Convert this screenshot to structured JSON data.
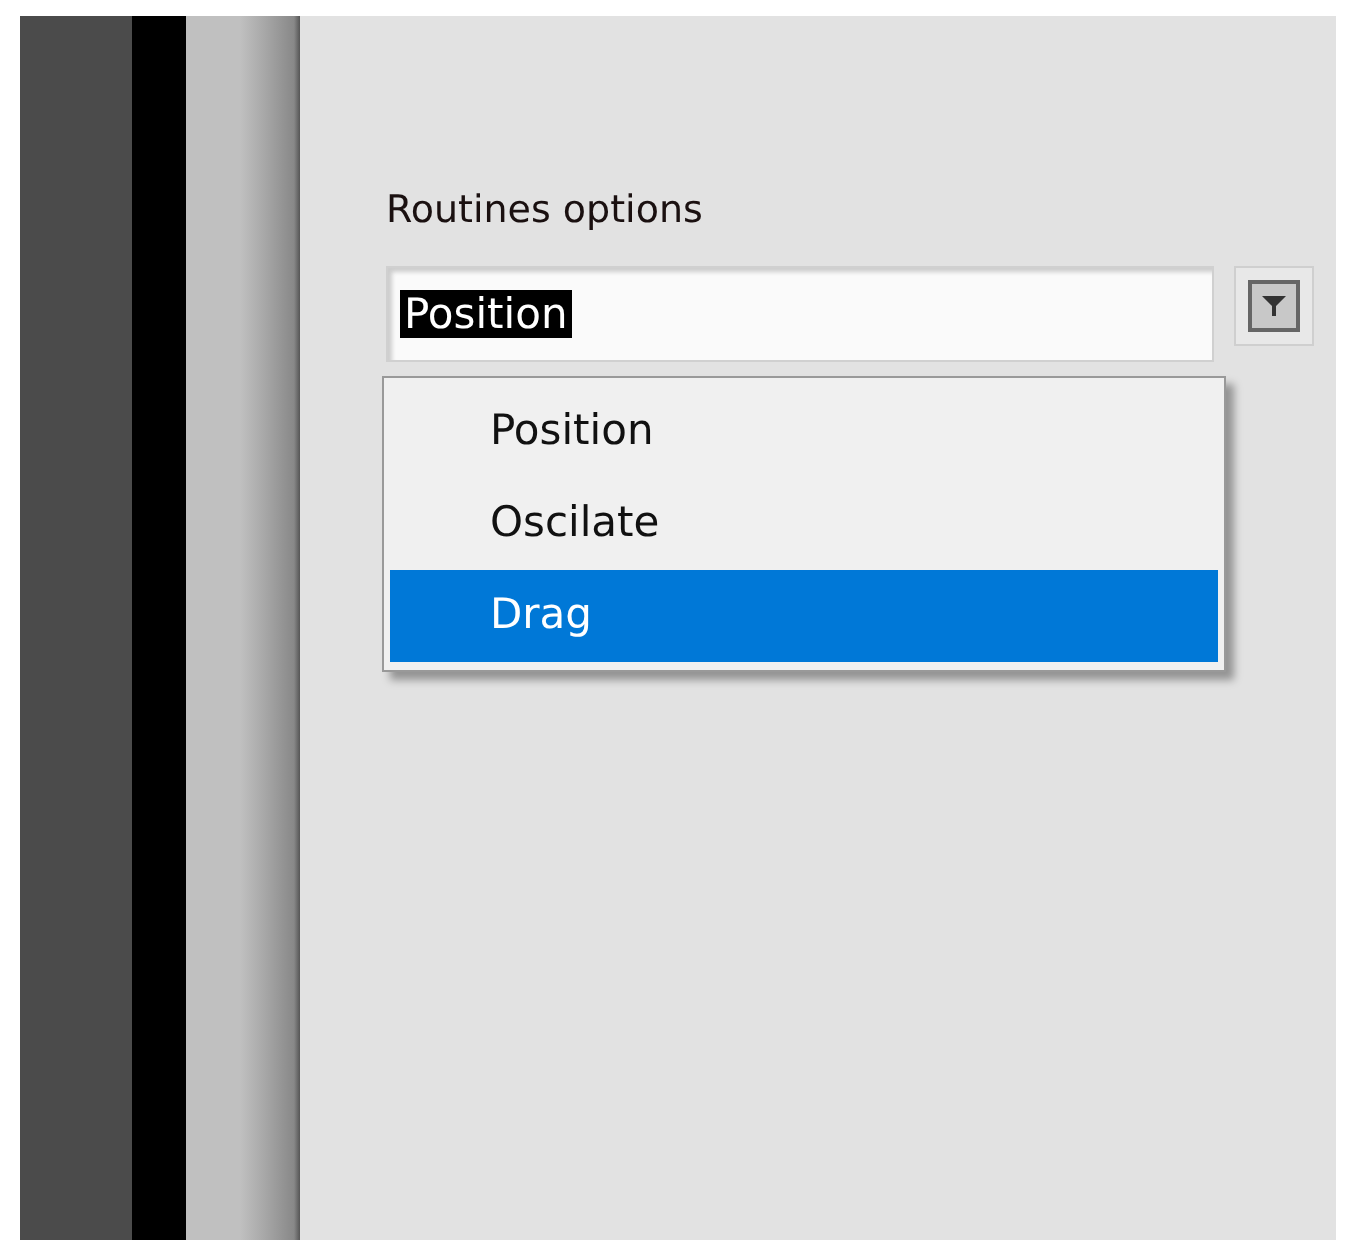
{
  "control": {
    "label": "Routines options",
    "value": "Position",
    "value_highlighted": true,
    "expanded": true
  },
  "options": [
    {
      "label": "Position",
      "selected": false
    },
    {
      "label": "Oscilate",
      "selected": false
    },
    {
      "label": "Drag",
      "selected": true
    }
  ]
}
